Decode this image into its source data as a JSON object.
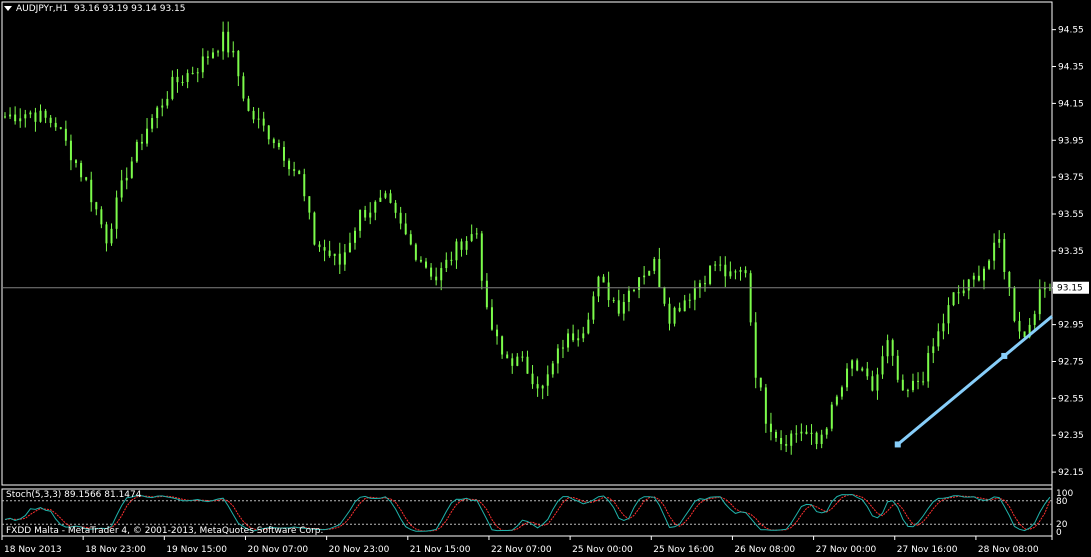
{
  "header": {
    "symbol": "AUDJPYr,H1",
    "ohlc": "93.16 93.19 93.14 93.15"
  },
  "indicator": {
    "label": "Stoch(5,3,3) 89.1566 81.1474",
    "levels": {
      "upper": "80",
      "lower": "20"
    },
    "scale": {
      "top": "100",
      "bottom": "0"
    }
  },
  "copyright": "FXDD Malta - MetaTrader 4, © 2001-2013, MetaQuotes Software Corp.",
  "colors": {
    "background": "#000000",
    "candle": "#7CFC4B",
    "trendline": "#87CEFA",
    "stoch_main": "#20B2AA",
    "stoch_signal": "#FF3030",
    "grid": "#808080"
  },
  "chart_data": {
    "type": "candlestick",
    "symbol": "AUDJPYr",
    "timeframe": "H1",
    "ylim": [
      92.08,
      94.7
    ],
    "y_ticks": [
      "94.55",
      "94.35",
      "94.15",
      "93.95",
      "93.75",
      "93.55",
      "93.35",
      "93.15",
      "92.95",
      "92.75",
      "92.55",
      "92.35",
      "92.15"
    ],
    "y_tick_values": [
      94.55,
      94.35,
      94.15,
      93.95,
      93.75,
      93.55,
      93.35,
      93.15,
      92.95,
      92.75,
      92.55,
      92.35,
      92.15
    ],
    "x_ticks": [
      "18 Nov 2013",
      "18 Nov 23:00",
      "19 Nov 15:00",
      "20 Nov 07:00",
      "20 Nov 23:00",
      "21 Nov 15:00",
      "22 Nov 07:00",
      "25 Nov 00:00",
      "25 Nov 16:00",
      "26 Nov 08:00",
      "27 Nov 00:00",
      "27 Nov 16:00",
      "28 Nov 08:00"
    ],
    "x_tick_bars": [
      0,
      16,
      32,
      48,
      64,
      80,
      96,
      112,
      128,
      144,
      160,
      176,
      192
    ],
    "bars_shown": 207,
    "current_price": 93.15,
    "price_path": [
      [
        0,
        94.08
      ],
      [
        5,
        94.1
      ],
      [
        10,
        94.04
      ],
      [
        16,
        93.72
      ],
      [
        20,
        93.42
      ],
      [
        24,
        93.78
      ],
      [
        28,
        94.02
      ],
      [
        33,
        94.25
      ],
      [
        38,
        94.35
      ],
      [
        43,
        94.5
      ],
      [
        45,
        94.4
      ],
      [
        48,
        94.1
      ],
      [
        53,
        93.96
      ],
      [
        58,
        93.75
      ],
      [
        61,
        93.4
      ],
      [
        66,
        93.28
      ],
      [
        70,
        93.55
      ],
      [
        75,
        93.62
      ],
      [
        80,
        93.38
      ],
      [
        85,
        93.2
      ],
      [
        90,
        93.4
      ],
      [
        93,
        93.45
      ],
      [
        95,
        93.0
      ],
      [
        98,
        92.78
      ],
      [
        102,
        92.74
      ],
      [
        106,
        92.6
      ],
      [
        110,
        92.85
      ],
      [
        114,
        92.94
      ],
      [
        117,
        93.18
      ],
      [
        121,
        93.05
      ],
      [
        125,
        93.22
      ],
      [
        128,
        93.28
      ],
      [
        131,
        93.0
      ],
      [
        136,
        93.15
      ],
      [
        140,
        93.28
      ],
      [
        143,
        93.2
      ],
      [
        146,
        93.25
      ],
      [
        148,
        92.7
      ],
      [
        150,
        92.45
      ],
      [
        153,
        92.32
      ],
      [
        157,
        92.38
      ],
      [
        160,
        92.3
      ],
      [
        163,
        92.48
      ],
      [
        167,
        92.74
      ],
      [
        171,
        92.6
      ],
      [
        174,
        92.84
      ],
      [
        177,
        92.55
      ],
      [
        181,
        92.68
      ],
      [
        184,
        92.9
      ],
      [
        187,
        93.1
      ],
      [
        190,
        93.16
      ],
      [
        194,
        93.3
      ],
      [
        196,
        93.4
      ],
      [
        199,
        93.0
      ],
      [
        201,
        92.88
      ],
      [
        203,
        93.05
      ],
      [
        205,
        93.15
      ],
      [
        206,
        93.15
      ]
    ],
    "trendline": {
      "points": [
        {
          "bar": 176,
          "price": 92.3
        },
        {
          "bar": 197,
          "price": 92.78
        },
        {
          "bar": 218,
          "price": 93.22
        }
      ],
      "extends_right": true
    },
    "stochastic": {
      "params": "5,3,3",
      "main": 89.1566,
      "signal": 81.1474,
      "levels": [
        80,
        20
      ],
      "ylim": [
        0,
        100
      ]
    }
  }
}
